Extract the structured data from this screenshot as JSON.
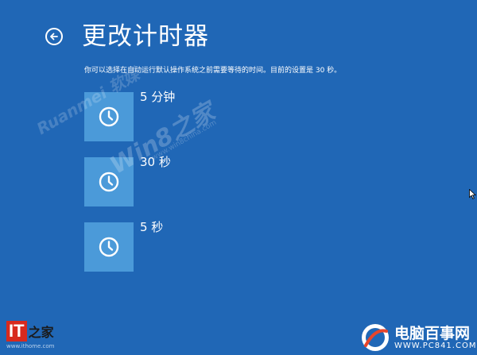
{
  "header": {
    "title": "更改计时器",
    "back_icon": "back-arrow-icon"
  },
  "description": "你可以选择在自动运行默认操作系统之前需要等待的时间。目前的设置是 30 秒。",
  "options": [
    {
      "label": "5 分钟",
      "icon": "clock-icon"
    },
    {
      "label": "30 秒",
      "icon": "clock-icon"
    },
    {
      "label": "5 秒",
      "icon": "clock-icon"
    }
  ],
  "colors": {
    "background": "#2067b6",
    "tile": "#4b9ad9",
    "text": "#ffffff"
  },
  "watermarks": {
    "ruanmei": "Ruanmei 软媒",
    "win8": "Win8之家",
    "win8_site": "www.win8china.com",
    "ithome_brand": "IT",
    "ithome_name": "之家",
    "ithome_url": "www.ithome.com",
    "pc841_name": "电脑百事网",
    "pc841_url": "WWW.PC841.COM"
  }
}
